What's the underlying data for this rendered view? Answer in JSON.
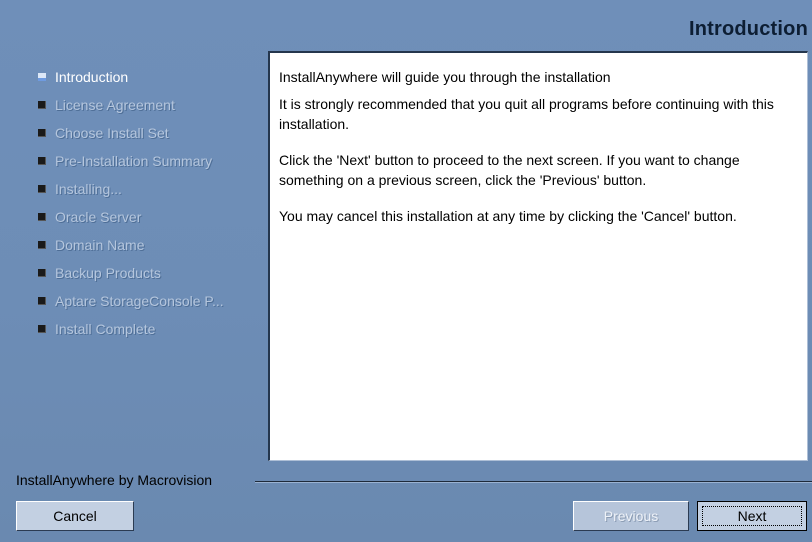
{
  "header": {
    "title": "Introduction"
  },
  "steps": [
    {
      "label": "Introduction",
      "active": true
    },
    {
      "label": "License Agreement",
      "active": false
    },
    {
      "label": "Choose Install Set",
      "active": false
    },
    {
      "label": "Pre-Installation Summary",
      "active": false
    },
    {
      "label": "Installing...",
      "active": false
    },
    {
      "label": "Oracle Server",
      "active": false
    },
    {
      "label": "Domain Name",
      "active": false
    },
    {
      "label": "Backup Products",
      "active": false
    },
    {
      "label": "Aptare StorageConsole P...",
      "active": false
    },
    {
      "label": "Install Complete",
      "active": false
    }
  ],
  "content": {
    "paragraphs": [
      "InstallAnywhere will guide you through the installation",
      "It is strongly recommended that you quit all programs before continuing with this installation.",
      "Click the 'Next' button to proceed to the next screen. If you want to change something on a previous screen, click the 'Previous' button.",
      "You may cancel this installation at any time by clicking the 'Cancel' button."
    ]
  },
  "footer": {
    "vendor": "InstallAnywhere by Macrovision",
    "cancel_label": "Cancel",
    "previous_label": "Previous",
    "next_label": "Next"
  },
  "colors": {
    "background": "#6e8fb8",
    "button_face": "#c3d0e2",
    "active_step": "#ffffff",
    "inactive_step": "#b5c6dd"
  }
}
